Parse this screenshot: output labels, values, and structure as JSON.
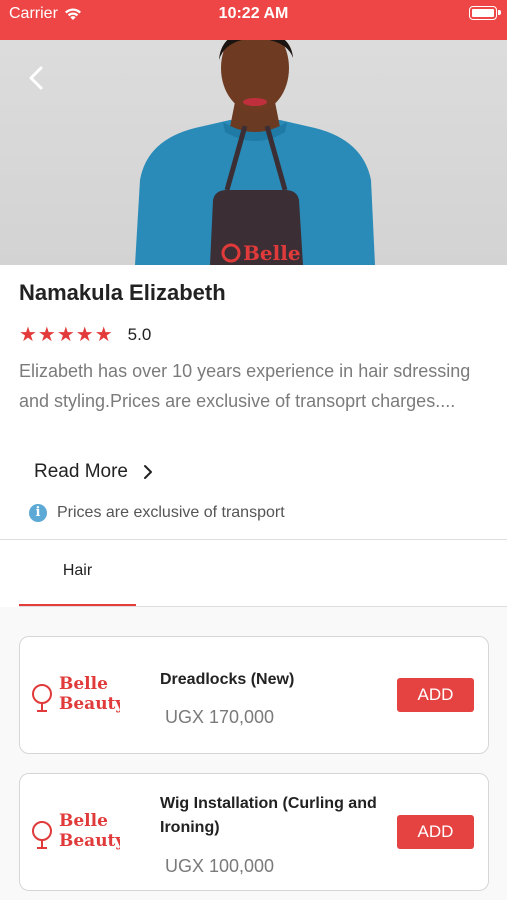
{
  "status_bar": {
    "carrier": "Carrier",
    "time": "10:22 AM"
  },
  "hero": {
    "apron_logo_text": "Belle"
  },
  "profile": {
    "name": "Namakula Elizabeth",
    "stars": "★★★★★",
    "rating": "5.0",
    "description": "Elizabeth has over 10 years experience in hair sdressing and styling.Prices are exclusive of transoprt charges....",
    "read_more": "Read More",
    "notice": "Prices are exclusive of transport"
  },
  "tabs": [
    {
      "label": "Hair",
      "active": true
    }
  ],
  "services": [
    {
      "name": "Dreadlocks (New)",
      "price": "UGX 170,000",
      "add_label": "ADD",
      "logo_line1": "Belle",
      "logo_line2": "Beauty"
    },
    {
      "name": "Wig Installation (Curling and Ironing)",
      "price": "UGX 100,000",
      "add_label": "ADD",
      "logo_line1": "Belle",
      "logo_line2": "Beauty"
    }
  ],
  "colors": {
    "accent": "#e54242",
    "status_bar": "#ee4646",
    "info": "#5ca9d6"
  },
  "icons": {
    "back": "chevron-left-icon",
    "wifi": "wifi-icon",
    "battery": "battery-icon",
    "read_more": "chevron-right-icon",
    "info": "info-icon"
  }
}
